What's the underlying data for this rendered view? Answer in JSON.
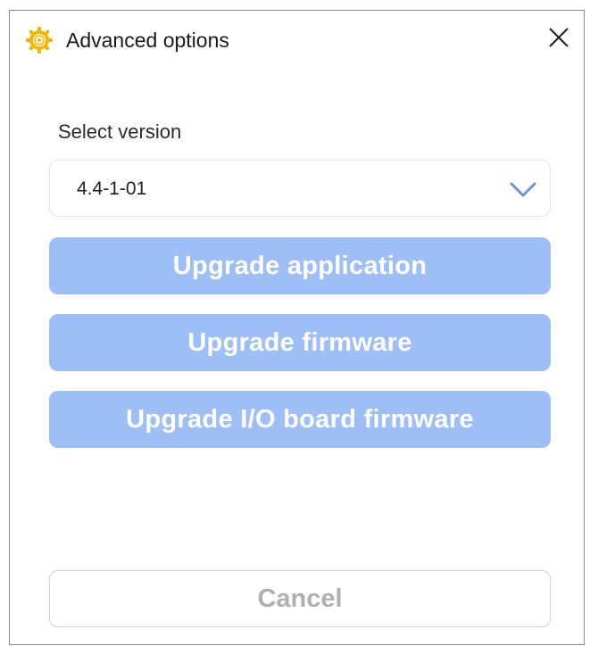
{
  "window": {
    "title": "Advanced options",
    "app_icon": "gear-sun-icon",
    "close_icon": "close-icon"
  },
  "version": {
    "label": "Select version",
    "selected": "4.4-1-01",
    "chevron_icon": "chevron-down-icon"
  },
  "actions": {
    "upgrade_application": "Upgrade application",
    "upgrade_firmware": "Upgrade firmware",
    "upgrade_io_firmware": "Upgrade I/O board firmware"
  },
  "footer": {
    "cancel_label": "Cancel"
  },
  "colors": {
    "accent_disabled": "#9ebff5",
    "icon_yellow": "#f2b705",
    "chevron_blue": "#6b93d8"
  }
}
